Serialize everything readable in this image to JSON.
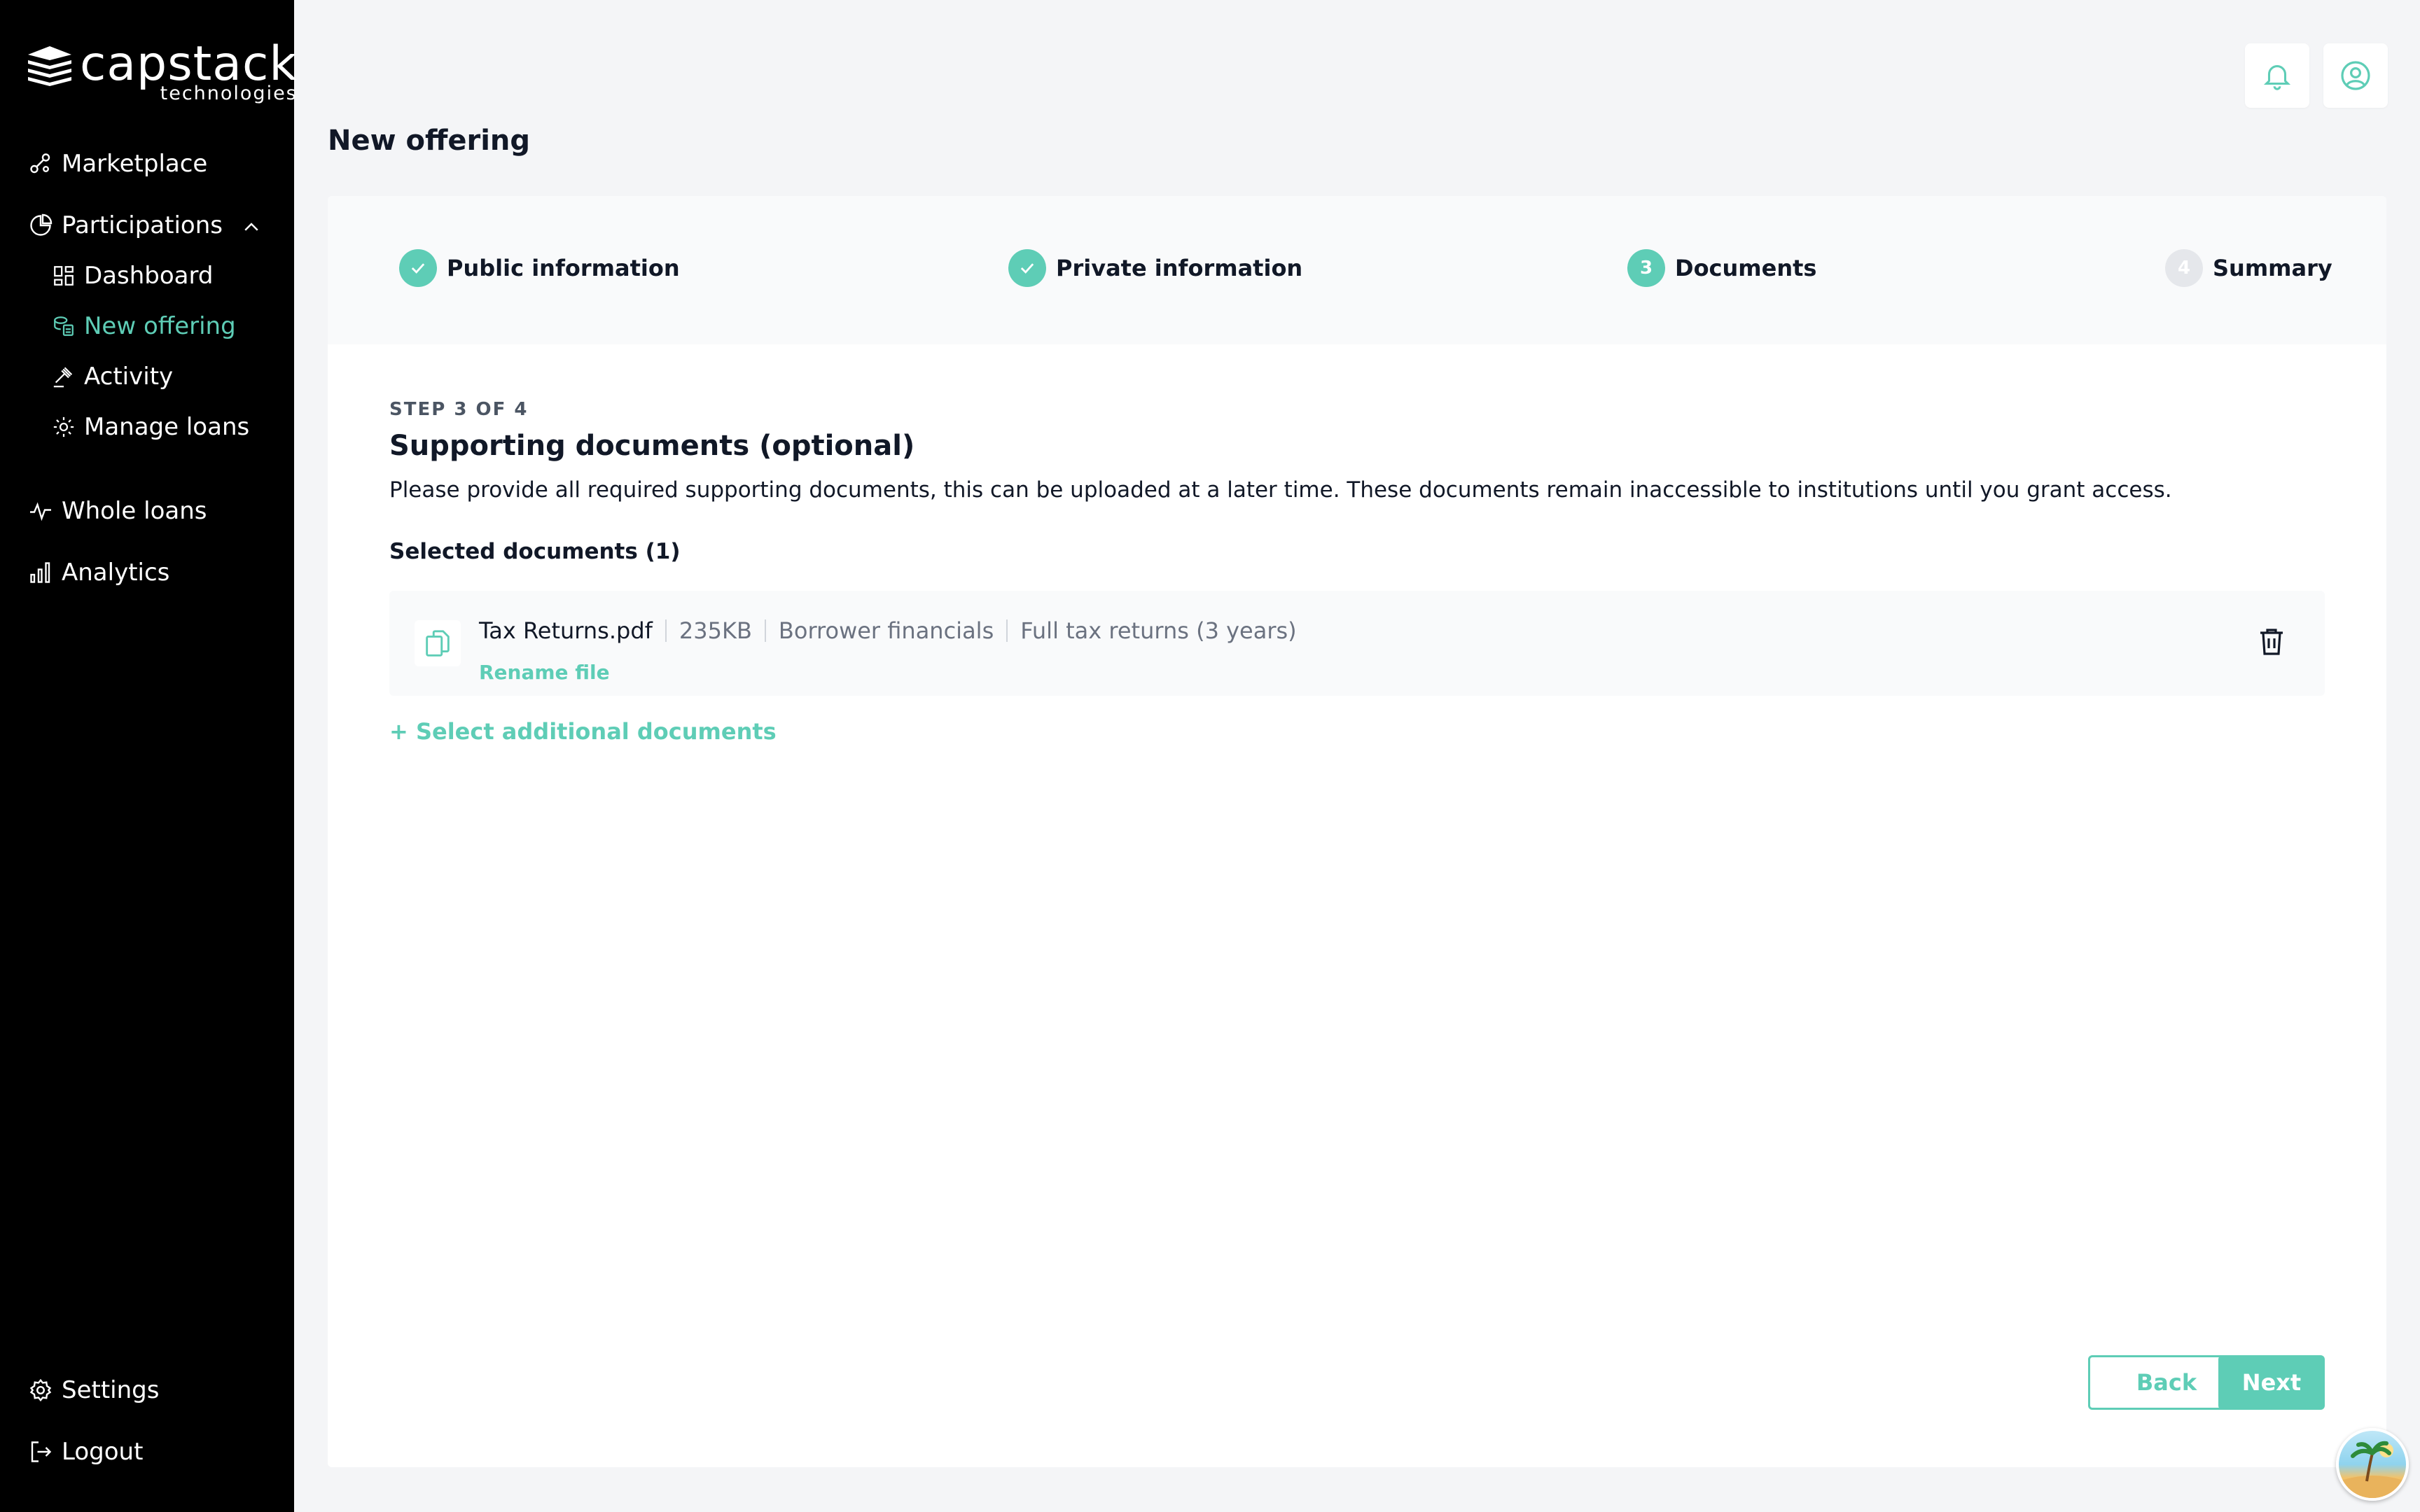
{
  "brand": {
    "name": "capstack",
    "sub": "technologies"
  },
  "sidebar": {
    "items": [
      {
        "label": "Marketplace",
        "icon": "marketplace-icon"
      },
      {
        "label": "Participations",
        "icon": "pie-chart-icon"
      },
      {
        "label": "Dashboard",
        "icon": "dashboard-icon"
      },
      {
        "label": "New offering",
        "icon": "new-offering-icon",
        "active": true
      },
      {
        "label": "Activity",
        "icon": "gavel-icon"
      },
      {
        "label": "Manage loans",
        "icon": "gear-doc-icon"
      },
      {
        "label": "Whole loans",
        "icon": "pulse-icon"
      },
      {
        "label": "Analytics",
        "icon": "bar-chart-icon"
      }
    ],
    "bottom": [
      {
        "label": "Settings",
        "icon": "gear-icon"
      },
      {
        "label": "Logout",
        "icon": "logout-icon"
      }
    ]
  },
  "header": {
    "title": "New offering"
  },
  "stepper": {
    "steps": [
      {
        "label": "Public information",
        "state": "done",
        "marker": ""
      },
      {
        "label": "Private information",
        "state": "done",
        "marker": ""
      },
      {
        "label": "Documents",
        "state": "current",
        "marker": "3"
      },
      {
        "label": "Summary",
        "state": "pending",
        "marker": "4"
      }
    ]
  },
  "content": {
    "step_label": "STEP 3 OF 4",
    "title": "Supporting documents (optional)",
    "description": "Please provide all required supporting documents, this can be uploaded at a later time. These documents remain inaccessible to institutions until you grant access.",
    "selected_label": "Selected documents (1)",
    "documents": [
      {
        "name": "Tax Returns.pdf",
        "size": "235KB",
        "category": "Borrower financials",
        "type": "Full tax returns (3 years)",
        "rename_label": "Rename file"
      }
    ],
    "add_label": "+ Select additional documents"
  },
  "actions": {
    "back_label": "Back",
    "next_label": "Next"
  },
  "colors": {
    "accent": "#5ecdb6",
    "sidebar": "#000000",
    "background": "#f4f5f7"
  }
}
